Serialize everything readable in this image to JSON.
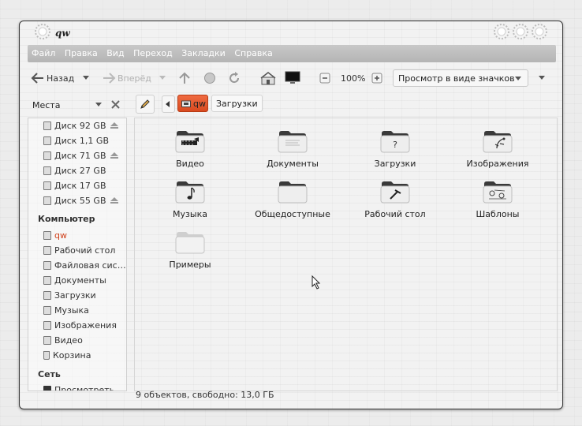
{
  "window": {
    "title": "qw"
  },
  "menu": [
    "Файл",
    "Правка",
    "Вид",
    "Переход",
    "Закладки",
    "Справка"
  ],
  "toolbar": {
    "back": "Назад",
    "forward": "Вперёд",
    "zoom": "100%",
    "view_mode": "Просмотр в виде значков"
  },
  "locationbar": {
    "crumbs": [
      "qw",
      "Загрузки"
    ]
  },
  "sidebar": {
    "title": "Места",
    "disks": [
      {
        "label": "Диск 92 GB",
        "eject": true
      },
      {
        "label": "Диск 1,1 GB",
        "eject": false
      },
      {
        "label": "Диск 71 GB",
        "eject": true
      },
      {
        "label": "Диск 27 GB",
        "eject": false
      },
      {
        "label": "Диск 17 GB",
        "eject": false
      },
      {
        "label": "Диск 55 GB",
        "eject": true
      }
    ],
    "computer_header": "Компьютер",
    "computer": [
      "qw",
      "Рабочий стол",
      "Файловая сис…",
      "Документы",
      "Загрузки",
      "Музыка",
      "Изображения",
      "Видео",
      "Корзина"
    ],
    "network_header": "Сеть",
    "network": [
      "Просмотреть …"
    ]
  },
  "files": [
    {
      "name": "Видео",
      "icon": "video-folder-icon"
    },
    {
      "name": "Документы",
      "icon": "documents-folder-icon"
    },
    {
      "name": "Загрузки",
      "icon": "downloads-folder-icon"
    },
    {
      "name": "Изображения",
      "icon": "pictures-folder-icon"
    },
    {
      "name": "Музыка",
      "icon": "music-folder-icon"
    },
    {
      "name": "Общедоступные",
      "icon": "public-folder-icon"
    },
    {
      "name": "Рабочий стол",
      "icon": "desktop-folder-icon"
    },
    {
      "name": "Шаблоны",
      "icon": "templates-folder-icon"
    },
    {
      "name": "Примеры",
      "icon": "examples-folder-icon"
    }
  ],
  "status": "9 объектов, свободно: 13,0 ГБ",
  "colors": {
    "accent": "#e8522a",
    "menubar": "#bcbcbc"
  }
}
